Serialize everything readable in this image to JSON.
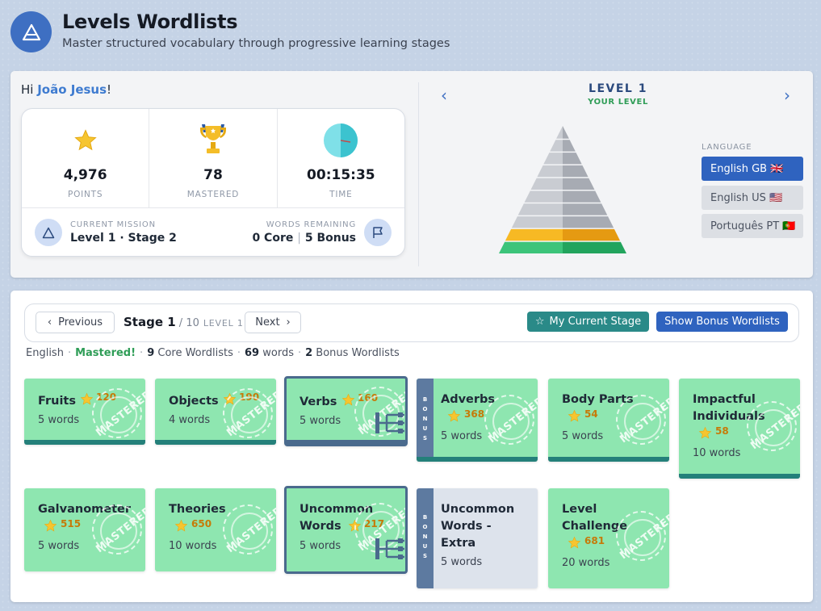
{
  "header": {
    "title": "Levels Wordlists",
    "subtitle": "Master structured vocabulary through progressive learning stages",
    "logo_icon": "triangle-logo-icon"
  },
  "greeting": {
    "prefix": "Hi ",
    "name": "João Jesus",
    "suffix": "!"
  },
  "stats": {
    "points": {
      "value": "4,976",
      "label": "POINTS",
      "icon": "star-icon"
    },
    "mastered": {
      "value": "78",
      "label": "MASTERED",
      "icon": "trophy-icon"
    },
    "time": {
      "value": "00:15:35",
      "label": "TIME",
      "icon": "clock-icon"
    }
  },
  "mission": {
    "label": "CURRENT MISSION",
    "value": "Level 1 · Stage 2"
  },
  "remaining": {
    "label": "WORDS REMAINING",
    "core": "0 Core",
    "sep": "|",
    "bonus": "5 Bonus"
  },
  "level": {
    "title": "LEVEL 1",
    "subtitle": "YOUR LEVEL",
    "prev": "‹",
    "next": "›"
  },
  "language": {
    "label": "LANGUAGE",
    "options": [
      "English GB 🇬🇧",
      "English US 🇺🇸",
      "Português PT 🇵🇹"
    ],
    "selected": "English GB 🇬🇧"
  },
  "toolbar": {
    "previous": "Previous",
    "next": "Next",
    "stage_word": "Stage 1",
    "stage_total": " / 10",
    "stage_level": "LEVEL 1",
    "my_stage": "My Current Stage",
    "show_bonus": "Show Bonus Wordlists"
  },
  "info": {
    "language": "English",
    "status": "Mastered!",
    "core_count": "9",
    "core_text": " Core Wordlists",
    "words_count": "69",
    "words_text": " words",
    "bonus_count": "2",
    "bonus_text": " Bonus Wordlists"
  },
  "stamp_text": "MASTERED",
  "bonus_label": [
    "B",
    "O",
    "N",
    "U",
    "S"
  ],
  "tiles": [
    {
      "title": "Fruits",
      "points": "120",
      "words": "5 words"
    },
    {
      "title": "Objects",
      "points": "190",
      "words": "4 words"
    },
    {
      "title": "Verbs",
      "points": "160",
      "words": "5 words"
    },
    {
      "title": "Adverbs",
      "points": "368",
      "words": "5 words"
    },
    {
      "title": "Body Parts",
      "points": "54",
      "words": "5 words"
    },
    {
      "title": "Impactful Individuals",
      "points": "58",
      "words": "10 words"
    },
    {
      "title": "Galvanometer",
      "points": "515",
      "words": "5 words"
    },
    {
      "title": "Theories",
      "points": "650",
      "words": "10 words"
    },
    {
      "title": "Uncommon Words",
      "points": "217",
      "words": "5 words"
    },
    {
      "title": "Uncommon Words - Extra",
      "points": "",
      "words": "5 words"
    },
    {
      "title": "Level Challenge",
      "points": "681",
      "words": "20 words"
    }
  ]
}
